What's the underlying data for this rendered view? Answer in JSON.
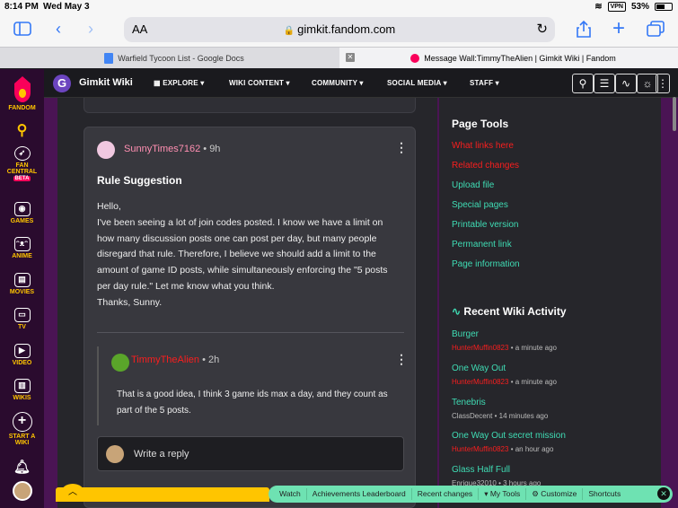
{
  "status": {
    "time": "8:14 PM",
    "date": "Wed May 3",
    "vpn": "VPN",
    "battery": "53%"
  },
  "browser": {
    "aa": "AA",
    "url": "gimkit.fandom.com"
  },
  "tabs": [
    {
      "title": "Warfield Tycoon List - Google Docs"
    },
    {
      "title": "Message Wall:TimmyTheAlien | Gimkit Wiki | Fandom"
    }
  ],
  "rail": [
    {
      "label": "FANDOM"
    },
    {
      "label": "FAN CENTRAL",
      "badge": "BETA"
    },
    {
      "label": "GAMES"
    },
    {
      "label": "ANIME"
    },
    {
      "label": "MOVIES"
    },
    {
      "label": "TV"
    },
    {
      "label": "VIDEO"
    },
    {
      "label": "WIKIS"
    },
    {
      "label": "START A WIKI"
    }
  ],
  "wiki": {
    "title": "Gimkit Wiki",
    "menu": [
      "EXPLORE",
      "WIKI CONTENT",
      "COMMUNITY",
      "SOCIAL MEDIA",
      "STAFF"
    ]
  },
  "post": {
    "author": "SunnyTimes7162",
    "time": "9h",
    "title": "Rule Suggestion",
    "body": [
      "Hello,",
      "I've been seeing a lot of join codes posted. I know we have a limit on how many discussion posts one can post per day, but many people disregard that rule. Therefore, I believe we should add a limit to the amount of game ID posts, while simultaneously enforcing the \"5 posts per day rule.\" Let me know what you think.",
      "Thanks, Sunny."
    ],
    "reply": {
      "author": "TimmyTheAlien",
      "time": "2h",
      "text": "That is a good idea, I think 3 game ids max a day, and they count as part of the 5 posts."
    },
    "reply_placeholder": "Write a reply"
  },
  "sidebar": {
    "tools_title": "Page Tools",
    "tools": [
      {
        "label": "What links here",
        "color": "red"
      },
      {
        "label": "Related changes",
        "color": "red"
      },
      {
        "label": "Upload file",
        "color": "green"
      },
      {
        "label": "Special pages",
        "color": "green"
      },
      {
        "label": "Printable version",
        "color": "green"
      },
      {
        "label": "Permanent link",
        "color": "green"
      },
      {
        "label": "Page information",
        "color": "green"
      }
    ],
    "activity_title": "Recent Wiki Activity",
    "activity": [
      {
        "page": "Burger",
        "user": "HunterMuffin0823",
        "when": "• a minute ago",
        "user_red": true
      },
      {
        "page": "One Way Out",
        "user": "HunterMuffin0823",
        "when": "• a minute ago",
        "user_red": true
      },
      {
        "page": "Tenebris",
        "user": "ClassDecent",
        "when": "• 14 minutes ago",
        "user_red": false
      },
      {
        "page": "One Way Out secret mission",
        "user": "HunterMuffin0823",
        "when": "• an hour ago",
        "user_red": true
      },
      {
        "page": "Glass Half Full",
        "user": "Enrique32010",
        "when": "• 3 hours ago",
        "user_red": false
      }
    ]
  },
  "bottombar": [
    "Watch",
    "Achievements Leaderboard",
    "Recent changes",
    "My Tools",
    "Customize",
    "Shortcuts"
  ],
  "colors": {
    "accent": "#3fdcb4",
    "link_red": "#fa1e1e",
    "brand": "#fa005a",
    "gold": "#ffc500"
  }
}
